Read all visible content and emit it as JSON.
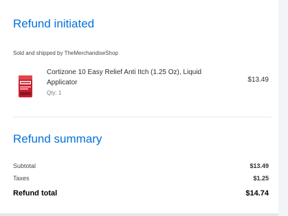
{
  "refund": {
    "heading": "Refund initiated",
    "sold_by": "Sold and shipped by TheMerchandiseShop"
  },
  "item": {
    "name": "Cortizone 10 Easy Relief Anti Itch (1.25 Oz), Liquid Applicator",
    "qty": "Qty: 1",
    "price": "$13.49",
    "thumbnail_icon": "product-image"
  },
  "summary": {
    "heading": "Refund summary",
    "rows": [
      {
        "label": "Subtotal",
        "value": "$13.49"
      },
      {
        "label": "Taxes",
        "value": "$1.25"
      }
    ],
    "total_label": "Refund total",
    "total_value": "$14.74"
  },
  "colors": {
    "accent": "#0071dc",
    "text": "#2e2f32",
    "muted": "#74767c",
    "product_red": "#c8202f"
  }
}
